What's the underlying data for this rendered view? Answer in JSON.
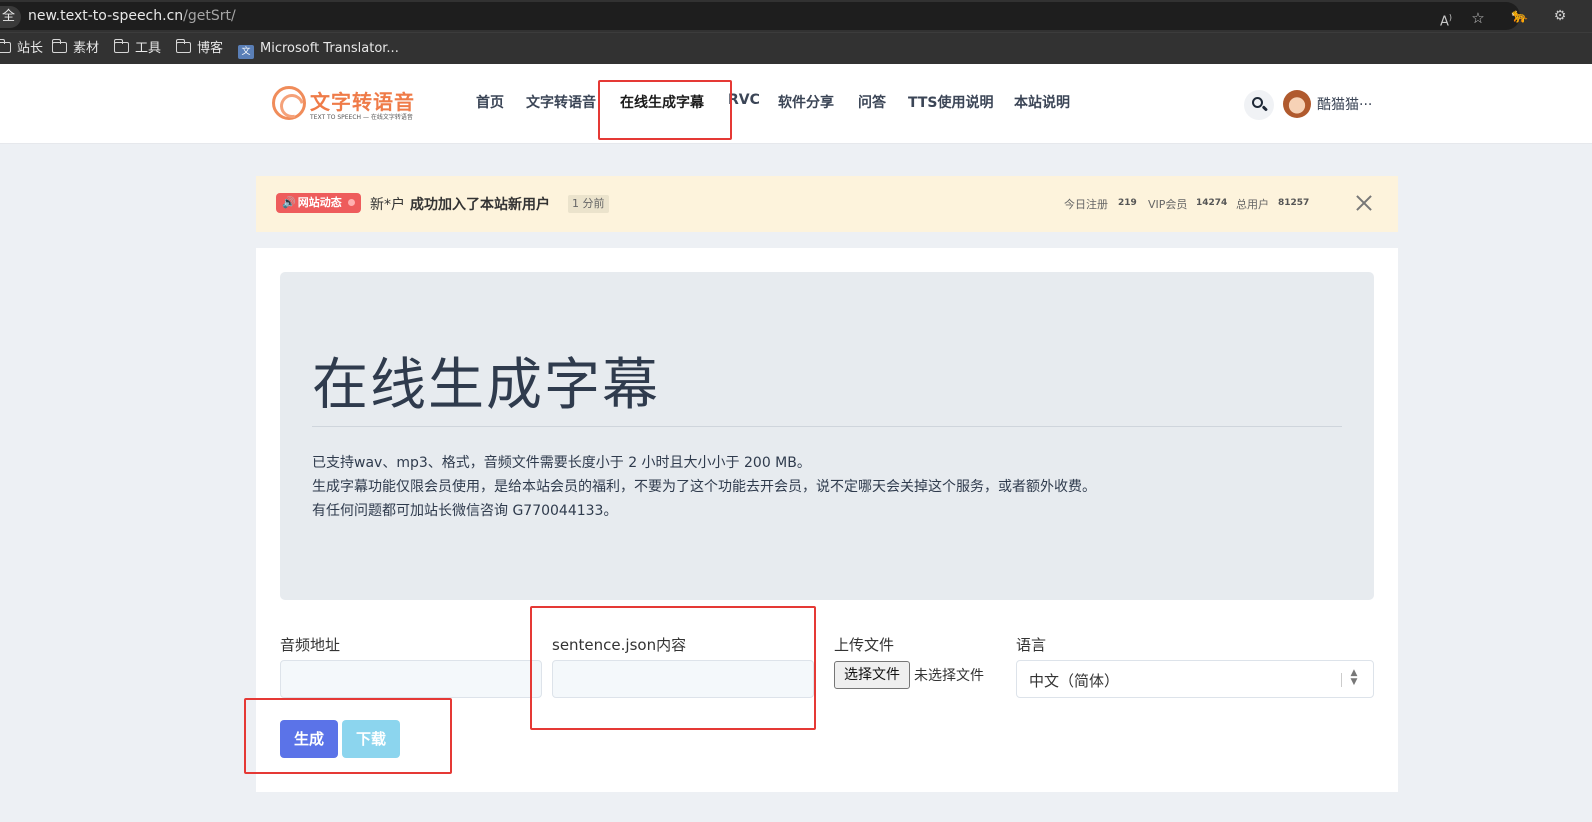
{
  "browser": {
    "secure_label": "全",
    "url_host": "new.text-to-speech.cn",
    "url_path": "/getSrt/",
    "bookmarks": [
      "站长",
      "素材",
      "工具",
      "博客",
      "Microsoft Translator..."
    ]
  },
  "header": {
    "logo_title": "文字转语音",
    "logo_subtitle": "TEXT TO SPEECH — 在线文字转语音",
    "nav": [
      "首页",
      "文字转语音",
      "在线生成字幕",
      "RVC",
      "软件分享",
      "问答",
      "TTS使用说明",
      "本站说明"
    ],
    "active_nav": "在线生成字幕",
    "user_name": "酷猫猫···"
  },
  "notice": {
    "badge": "网站动态",
    "user": "新*户",
    "message": "成功加入了本站新用户",
    "time": "1 分前",
    "stats": [
      {
        "label": "今日注册",
        "value": "219"
      },
      {
        "label": "VIP会员",
        "value": "14274"
      },
      {
        "label": "总用户",
        "value": "81257"
      }
    ]
  },
  "hero": {
    "title": "在线生成字幕",
    "lines": [
      "已支持wav、mp3、格式，音频文件需要长度小于 2 小时且大小小于 200 MB。",
      "生成字幕功能仅限会员使用，是给本站会员的福利，不要为了这个功能去开会员，说不定哪天会关掉这个服务，或者额外收费。",
      "有任何问题都可加站长微信咨询 G770044133。"
    ]
  },
  "form": {
    "audio_label": "音频地址",
    "sentence_label": "sentence.json内容",
    "upload_label": "上传文件",
    "file_button": "选择文件",
    "file_status": "未选择文件",
    "language_label": "语言",
    "language_value": "中文（简体）",
    "generate_button": "生成",
    "download_button": "下载"
  },
  "colors": {
    "annotation": "#e53935",
    "primary": "#5b73e8",
    "info": "#8cd5ee",
    "brand": "#ef7b48"
  }
}
